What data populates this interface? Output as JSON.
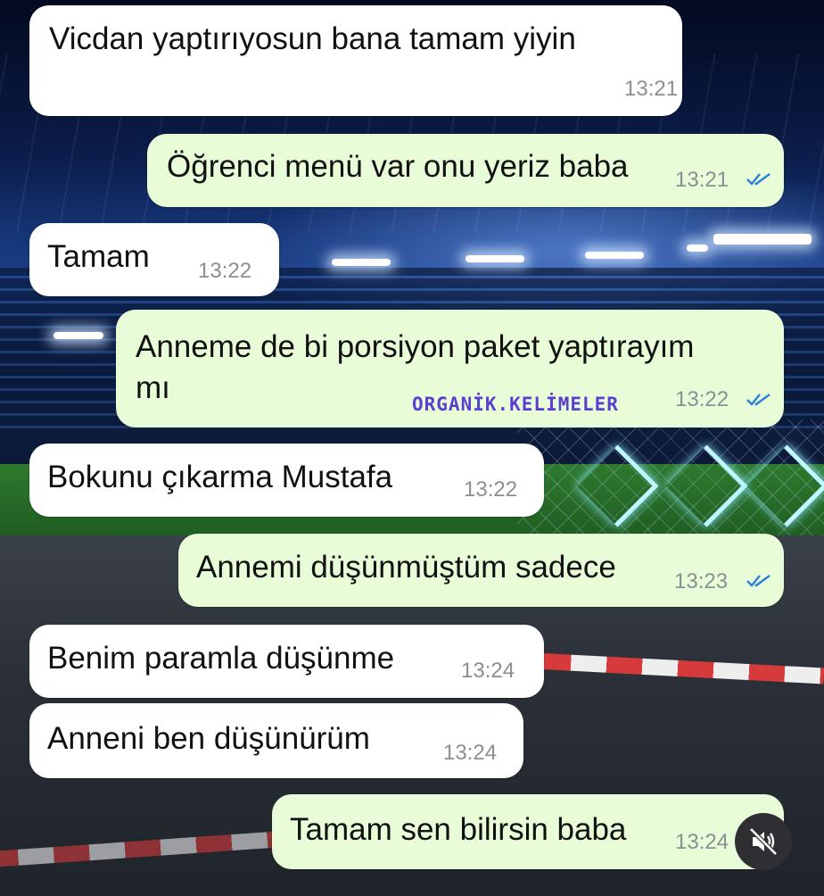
{
  "messages": [
    {
      "dir": "in",
      "lines": [
        "Vicdan yaptırıyosun bana tamam yiyin"
      ],
      "time": "13:21"
    },
    {
      "dir": "out",
      "lines": [
        "Öğrenci menü var onu yeriz baba"
      ],
      "time": "13:21",
      "read": true
    },
    {
      "dir": "in",
      "lines": [
        "Tamam"
      ],
      "time": "13:22"
    },
    {
      "dir": "out",
      "lines": [
        "Anneme de bi porsiyon paket yaptırayım",
        "mı"
      ],
      "time": "13:22",
      "read": true
    },
    {
      "dir": "in",
      "lines": [
        "Bokunu çıkarma Mustafa"
      ],
      "time": "13:22"
    },
    {
      "dir": "out",
      "lines": [
        "Annemi düşünmüştüm sadece"
      ],
      "time": "13:23",
      "read": true
    },
    {
      "dir": "in",
      "lines": [
        "Benim paramla düşünme"
      ],
      "time": "13:24"
    },
    {
      "dir": "in",
      "lines": [
        "Anneni ben düşünürüm"
      ],
      "time": "13:24"
    },
    {
      "dir": "out",
      "lines": [
        "Tamam sen bilirsin baba"
      ],
      "time": "13:24"
    }
  ],
  "watermark": "ORGANİK.KELİMELER",
  "icons": {
    "read_receipt": "double-check-icon",
    "mute": "volume-muted-icon"
  },
  "colors": {
    "incoming": "#ffffff",
    "outgoing": "#e8fcd8",
    "tick": "#2b7fd8",
    "watermark": "#5a3fd0"
  }
}
